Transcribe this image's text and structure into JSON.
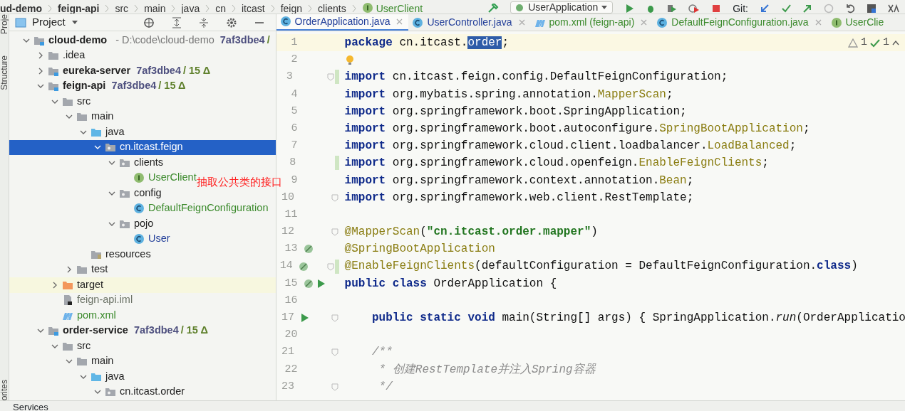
{
  "breadcrumbs": [
    {
      "label": "ud-demo",
      "kind": "module"
    },
    {
      "label": "feign-api",
      "kind": "module"
    },
    {
      "label": "src",
      "kind": "dir"
    },
    {
      "label": "main",
      "kind": "dir"
    },
    {
      "label": "java",
      "kind": "dir"
    },
    {
      "label": "cn",
      "kind": "dir"
    },
    {
      "label": "itcast",
      "kind": "dir"
    },
    {
      "label": "feign",
      "kind": "dir"
    },
    {
      "label": "clients",
      "kind": "dir"
    },
    {
      "label": "UserClient",
      "kind": "interface"
    }
  ],
  "toolbar": {
    "run_config": "UserApplication",
    "vcs_label": "Git:"
  },
  "side_strip": {
    "top": [
      "Proje",
      "Structure"
    ],
    "bottom": [
      "orites"
    ]
  },
  "project_panel": {
    "title": "Project",
    "tree": [
      {
        "label": "cloud-demo",
        "kind": "module",
        "expanded": true,
        "selected": false,
        "path": "- D:\\code\\cloud-demo",
        "rev": "7af3dbe4",
        "changes": "/",
        "children": [
          {
            "label": ".idea",
            "kind": "folder",
            "expanded": false,
            "selected": false
          },
          {
            "label": "eureka-server",
            "kind": "module",
            "expanded": false,
            "selected": false,
            "rev": "7af3dbe4",
            "changes": "/ 15 Δ"
          },
          {
            "label": "feign-api",
            "kind": "module",
            "expanded": true,
            "selected": false,
            "rev": "7af3dbe4",
            "changes": "/ 15 Δ",
            "children": [
              {
                "label": "src",
                "kind": "folder",
                "expanded": true,
                "selected": false,
                "children": [
                  {
                    "label": "main",
                    "kind": "folder",
                    "expanded": true,
                    "selected": false,
                    "children": [
                      {
                        "label": "java",
                        "kind": "source_root",
                        "expanded": true,
                        "selected": false,
                        "children": [
                          {
                            "label": "cn.itcast.feign",
                            "kind": "package",
                            "expanded": true,
                            "selected": true,
                            "children": [
                              {
                                "label": "clients",
                                "kind": "package",
                                "expanded": true,
                                "selected": false,
                                "children": [
                                  {
                                    "label": "UserClient",
                                    "kind": "interface",
                                    "selected": false,
                                    "color": "#3b8a2c"
                                  }
                                ]
                              },
                              {
                                "label": "config",
                                "kind": "package",
                                "expanded": true,
                                "selected": false,
                                "children": [
                                  {
                                    "label": "DefaultFeignConfiguration",
                                    "kind": "class",
                                    "selected": false,
                                    "color": "#3b8a2c"
                                  }
                                ]
                              },
                              {
                                "label": "pojo",
                                "kind": "package",
                                "expanded": true,
                                "selected": false,
                                "children": [
                                  {
                                    "label": "User",
                                    "kind": "class",
                                    "selected": false,
                                    "color": "#24409a"
                                  }
                                ]
                              }
                            ]
                          }
                        ]
                      },
                      {
                        "label": "resources",
                        "kind": "resources",
                        "selected": false
                      }
                    ]
                  },
                  {
                    "label": "test",
                    "kind": "folder",
                    "expanded": false,
                    "selected": false
                  }
                ]
              },
              {
                "label": "target",
                "kind": "excluded",
                "expanded": false,
                "selected": false
              },
              {
                "label": "feign-api.iml",
                "kind": "iml",
                "selected": false,
                "color": "#6b7266"
              },
              {
                "label": "pom.xml",
                "kind": "maven",
                "selected": false,
                "color": "#3b8a2c"
              }
            ]
          },
          {
            "label": "order-service",
            "kind": "module",
            "expanded": true,
            "selected": false,
            "rev": "7af3dbe4",
            "changes": "/ 15 Δ",
            "children": [
              {
                "label": "src",
                "kind": "folder",
                "expanded": true,
                "selected": false,
                "children": [
                  {
                    "label": "main",
                    "kind": "folder",
                    "expanded": true,
                    "selected": false,
                    "children": [
                      {
                        "label": "java",
                        "kind": "source_root",
                        "expanded": true,
                        "selected": false,
                        "children": [
                          {
                            "label": "cn.itcast.order",
                            "kind": "package",
                            "expanded": true,
                            "selected": false
                          }
                        ]
                      }
                    ]
                  }
                ]
              }
            ]
          }
        ]
      }
    ]
  },
  "editor": {
    "tabs": [
      {
        "label": "OrderApplication.java",
        "kind": "class",
        "selected": true,
        "closable": true,
        "color": "#24409a"
      },
      {
        "label": "UserController.java",
        "kind": "class",
        "selected": false,
        "closable": true,
        "color": "#24409a"
      },
      {
        "label": "pom.xml (feign-api)",
        "kind": "maven",
        "selected": false,
        "closable": true,
        "color": "#3b8a2c"
      },
      {
        "label": "DefaultFeignConfiguration.java",
        "kind": "class",
        "selected": false,
        "closable": true,
        "color": "#3b8a2c"
      },
      {
        "label": "UserClie",
        "kind": "interface",
        "selected": false,
        "closable": false,
        "color": "#3b8a2c"
      }
    ],
    "inspections": {
      "warnings": "1",
      "passed": "1"
    },
    "lines": [
      {
        "number": "1",
        "current": true,
        "parts": [
          {
            "kind": "kw",
            "text": "package"
          },
          {
            "kind": "plain",
            "text": " cn.itcast."
          },
          {
            "kind": "sel",
            "text": "order"
          },
          {
            "kind": "plain",
            "text": ";"
          }
        ]
      },
      {
        "number": "2",
        "current": false,
        "markers": [
          {
            "kind": "bulb"
          }
        ]
      },
      {
        "number": "3",
        "current": false,
        "markers": [
          {
            "kind": "fold"
          },
          {
            "kind": "change"
          }
        ],
        "parts": [
          {
            "kind": "kw",
            "text": "import"
          },
          {
            "kind": "plain",
            "text": " cn.itcast.feign.config.DefaultFeignConfiguration;"
          }
        ]
      },
      {
        "number": "4",
        "current": false,
        "parts": [
          {
            "kind": "kw",
            "text": "import"
          },
          {
            "kind": "plain",
            "text": " org.mybatis.spring.annotation."
          },
          {
            "kind": "annot",
            "text": "MapperScan"
          },
          {
            "kind": "plain",
            "text": ";"
          }
        ]
      },
      {
        "number": "5",
        "current": false,
        "parts": [
          {
            "kind": "kw",
            "text": "import"
          },
          {
            "kind": "plain",
            "text": " org.springframework.boot.SpringApplication;"
          }
        ]
      },
      {
        "number": "6",
        "current": false,
        "parts": [
          {
            "kind": "kw",
            "text": "import"
          },
          {
            "kind": "plain",
            "text": " org.springframework.boot.autoconfigure."
          },
          {
            "kind": "annot",
            "text": "SpringBootApplication"
          },
          {
            "kind": "plain",
            "text": ";"
          }
        ]
      },
      {
        "number": "7",
        "current": false,
        "parts": [
          {
            "kind": "kw",
            "text": "import"
          },
          {
            "kind": "plain",
            "text": " org.springframework.cloud.client.loadbalancer."
          },
          {
            "kind": "annot",
            "text": "LoadBalanced"
          },
          {
            "kind": "plain",
            "text": ";"
          }
        ]
      },
      {
        "number": "8",
        "current": false,
        "markers": [
          {
            "kind": "change"
          }
        ],
        "parts": [
          {
            "kind": "kw",
            "text": "import"
          },
          {
            "kind": "plain",
            "text": " org.springframework.cloud.openfeign."
          },
          {
            "kind": "annot",
            "text": "EnableFeignClients"
          },
          {
            "kind": "plain",
            "text": ";"
          }
        ]
      },
      {
        "number": "9",
        "current": false,
        "parts": [
          {
            "kind": "kw",
            "text": "import"
          },
          {
            "kind": "plain",
            "text": " org.springframework.context.annotation."
          },
          {
            "kind": "annot",
            "text": "Bean"
          },
          {
            "kind": "plain",
            "text": ";"
          }
        ]
      },
      {
        "number": "10",
        "current": false,
        "markers": [
          {
            "kind": "fold"
          }
        ],
        "parts": [
          {
            "kind": "kw",
            "text": "import"
          },
          {
            "kind": "plain",
            "text": " org.springframework.web.client.RestTemplate;"
          }
        ]
      },
      {
        "number": "11",
        "current": false
      },
      {
        "number": "12",
        "current": false,
        "markers": [
          {
            "kind": "fold"
          }
        ],
        "parts": [
          {
            "kind": "annot",
            "text": "@MapperScan"
          },
          {
            "kind": "plain",
            "text": "("
          },
          {
            "kind": "str",
            "text": "\"cn.itcast.order.mapper\""
          },
          {
            "kind": "plain",
            "text": ")"
          }
        ]
      },
      {
        "number": "13",
        "current": false,
        "markers": [
          {
            "kind": "bean"
          }
        ],
        "parts": [
          {
            "kind": "annot",
            "text": "@SpringBootApplication"
          }
        ]
      },
      {
        "number": "14",
        "current": false,
        "markers": [
          {
            "kind": "bean"
          },
          {
            "kind": "fold"
          },
          {
            "kind": "change"
          }
        ],
        "parts": [
          {
            "kind": "annot",
            "text": "@EnableFeignClients"
          },
          {
            "kind": "plain",
            "text": "(defaultConfiguration = DefaultFeignConfiguration."
          },
          {
            "kind": "kw",
            "text": "class"
          },
          {
            "kind": "plain",
            "text": ")"
          }
        ]
      },
      {
        "number": "15",
        "current": false,
        "markers": [
          {
            "kind": "bean"
          },
          {
            "kind": "run"
          }
        ],
        "parts": [
          {
            "kind": "kw",
            "text": "public class"
          },
          {
            "kind": "plain",
            "text": " OrderApplication {"
          }
        ]
      },
      {
        "number": "16",
        "current": false
      },
      {
        "number": "17",
        "current": false,
        "nested": true,
        "markers": [
          {
            "kind": "run"
          },
          {
            "kind": "fold"
          }
        ],
        "parts": [
          {
            "kind": "kw",
            "text": "public static void"
          },
          {
            "kind": "plain",
            "text": " main(String[] args) { SpringApplication."
          },
          {
            "kind": "static",
            "text": "run"
          },
          {
            "kind": "plain",
            "text": "(OrderApplicatio"
          }
        ]
      },
      {
        "number": "20",
        "current": false
      },
      {
        "number": "21",
        "current": false,
        "markers": [
          {
            "kind": "fold"
          }
        ],
        "nested": true,
        "parts": [
          {
            "kind": "doc",
            "text": "/**"
          }
        ]
      },
      {
        "number": "22",
        "current": false,
        "nested": true,
        "parts": [
          {
            "kind": "doc_cont",
            "text": "* 创建RestTemplate并注入Spring容器"
          }
        ]
      },
      {
        "number": "23",
        "current": false,
        "markers": [
          {
            "kind": "fold"
          }
        ],
        "nested": true,
        "parts": [
          {
            "kind": "doc_cont",
            "text": "*/"
          }
        ]
      }
    ]
  },
  "annotation": "抽取公共类的接口",
  "bottom_bar": {
    "tool_window": "Services"
  }
}
